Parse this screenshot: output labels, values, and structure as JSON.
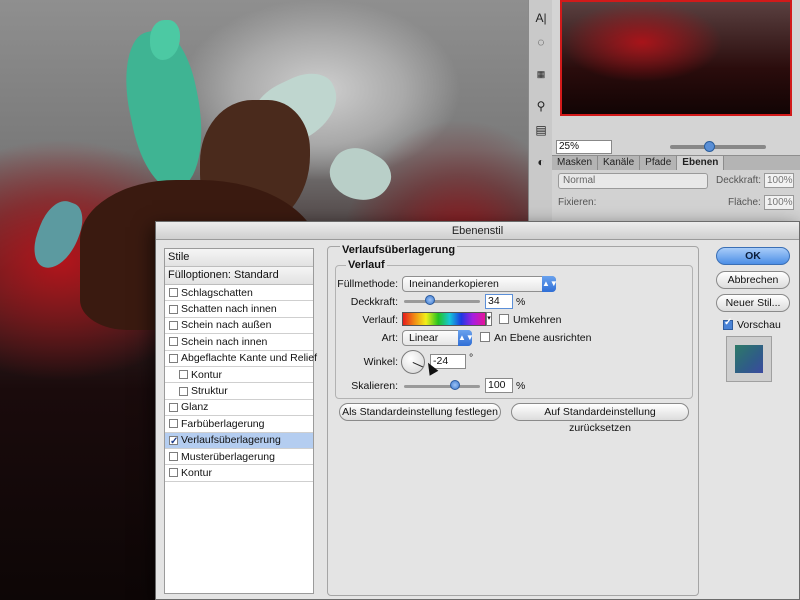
{
  "nav": {
    "zoom": "25%"
  },
  "layers_panel": {
    "tabs": [
      "Masken",
      "Kanäle",
      "Pfade",
      "Ebenen"
    ],
    "active_tab": "Ebenen",
    "blend_mode": "Normal",
    "opacity_label": "Deckkraft:",
    "opacity_value": "100%",
    "lock_label": "Fixieren:",
    "fill_label": "Fläche:",
    "fill_value": "100%"
  },
  "dialog": {
    "title": "Ebenenstil",
    "styles": {
      "header": "Stile",
      "blend_options": "Fülloptionen: Standard",
      "items": [
        {
          "label": "Schlagschatten",
          "checked": false,
          "sub": false,
          "selected": false
        },
        {
          "label": "Schatten nach innen",
          "checked": false,
          "sub": false,
          "selected": false
        },
        {
          "label": "Schein nach außen",
          "checked": false,
          "sub": false,
          "selected": false
        },
        {
          "label": "Schein nach innen",
          "checked": false,
          "sub": false,
          "selected": false
        },
        {
          "label": "Abgeflachte Kante und Relief",
          "checked": false,
          "sub": false,
          "selected": false
        },
        {
          "label": "Kontur",
          "checked": false,
          "sub": true,
          "selected": false
        },
        {
          "label": "Struktur",
          "checked": false,
          "sub": true,
          "selected": false
        },
        {
          "label": "Glanz",
          "checked": false,
          "sub": false,
          "selected": false
        },
        {
          "label": "Farbüberlagerung",
          "checked": false,
          "sub": false,
          "selected": false
        },
        {
          "label": "Verlaufsüberlagerung",
          "checked": true,
          "sub": false,
          "selected": true
        },
        {
          "label": "Musterüberlagerung",
          "checked": false,
          "sub": false,
          "selected": false
        },
        {
          "label": "Kontur",
          "checked": false,
          "sub": false,
          "selected": false
        }
      ]
    },
    "section_title": "Verlaufsüberlagerung",
    "subsection_title": "Verlauf",
    "fill_method_label": "Füllmethode:",
    "fill_method_value": "Ineinanderkopieren",
    "opacity_label": "Deckkraft:",
    "opacity_value": "34",
    "opacity_level": 34,
    "percent": "%",
    "gradient_label": "Verlauf:",
    "reverse_label": "Umkehren",
    "reverse_checked": false,
    "style_label": "Art:",
    "style_value": "Linear",
    "align_label": "An Ebene ausrichten",
    "align_checked": false,
    "angle_label": "Winkel:",
    "angle_value": "-24",
    "degree": "°",
    "scale_label": "Skalieren:",
    "scale_value": "100",
    "scale_level": 100,
    "make_default": "Als Standardeinstellung festlegen",
    "reset_default": "Auf Standardeinstellung zurücksetzen",
    "ok": "OK",
    "cancel": "Abbrechen",
    "new_style": "Neuer Stil...",
    "preview_label": "Vorschau",
    "preview_checked": true
  }
}
